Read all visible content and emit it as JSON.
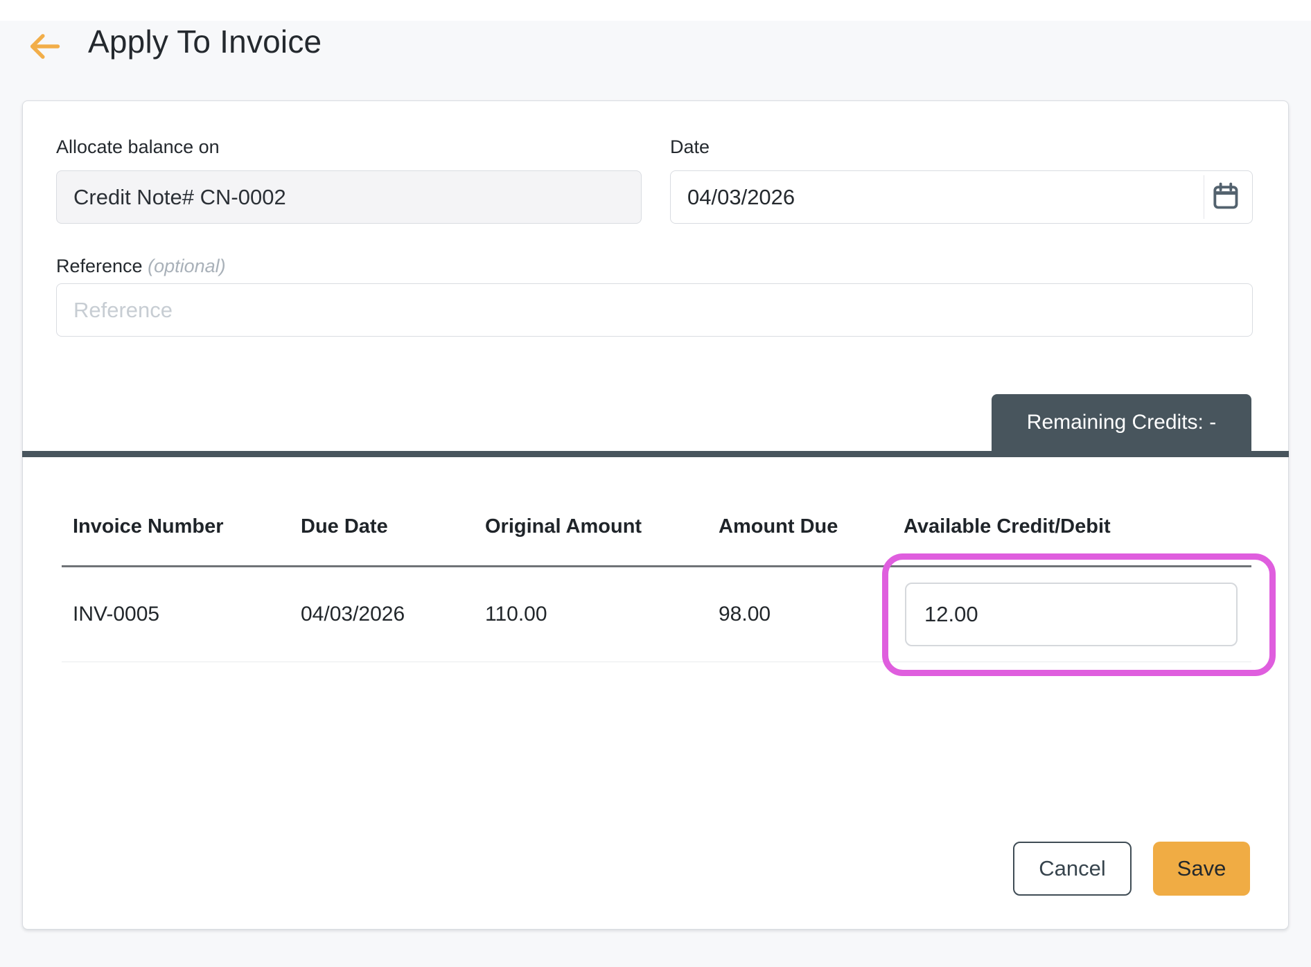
{
  "header": {
    "title": "Apply To Invoice",
    "back_icon": "arrow-left"
  },
  "form": {
    "allocate": {
      "label": "Allocate balance on",
      "value": "Credit Note# CN-0002"
    },
    "date": {
      "label": "Date",
      "value": "04/03/2026",
      "icon": "calendar"
    },
    "reference": {
      "label": "Reference",
      "optional_hint": "(optional)",
      "placeholder": "Reference",
      "value": ""
    }
  },
  "credits_badge": {
    "label": "Remaining Credits: -"
  },
  "table": {
    "headers": [
      "Invoice Number",
      "Due Date",
      "Original Amount",
      "Amount Due",
      "Available Credit/Debit"
    ],
    "rows": [
      {
        "invoice_number": "INV-0005",
        "due_date": "04/03/2026",
        "original_amount": "110.00",
        "amount_due": "98.00",
        "available_credit": "12.00"
      }
    ]
  },
  "actions": {
    "cancel_label": "Cancel",
    "save_label": "Save"
  },
  "annotation": {
    "type": "highlight-box",
    "target": "available-credit-input",
    "color": "#df5ede"
  },
  "colors": {
    "accent_orange": "#f0ac44",
    "dark_slate": "#48555d",
    "page_background": "#f7f8fa",
    "highlight_pink": "#df5ede"
  }
}
